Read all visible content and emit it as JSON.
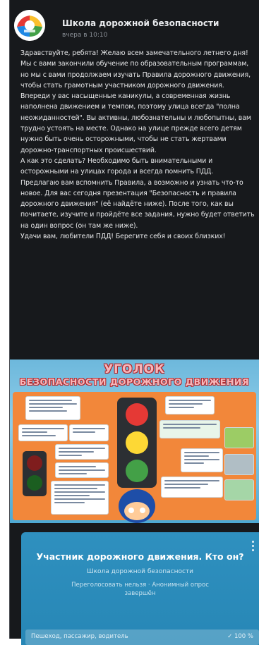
{
  "post": {
    "channel_name": "Школа дорожной безопасности",
    "time": "вчера в 10:10",
    "paragraphs": [
      "Здравствуйте, ребята! Желаю всем замечательного летнего дня!",
      "Мы с вами закончили обучение по образовательным программам, но мы с вами продолжаем изучать Правила дорожного движения, чтобы стать грамотным участником дорожного движения.",
      "Впереди у вас насыщенные каникулы, а современная жизнь наполнена движением и темпом, поэтому улица всегда \"полна неожиданностей\". Вы активны, любознательны и любопытны, вам трудно устоять на месте. Однако на улице прежде всего детям нужно быть очень осторожными, чтобы не стать жертвами дорожно-транспортных происшествий.",
      "А как это сделать? Необходимо быть внимательными и осторожными на улицах города и всегда помнить ПДД.",
      "Предлагаю вам вспомнить Правила, а возможно и узнать что-то новое. Для вас сегодня презентация \"Безопасность и правила дорожного движения\" (её найдёте ниже). После того, как вы почитаете, изучите и пройдёте все задания, нужно будет ответить на один вопрос (он там же ниже).",
      "Удачи вам, любители ПДД! Берегите себя и своих близких!"
    ]
  },
  "poster": {
    "title_line1": "УГОЛОК",
    "title_line2": "БЕЗОПАСНОСТИ ДОРОЖНОГО ДВИЖЕНИЯ"
  },
  "poll": {
    "question": "Участник дорожного движения. Кто он?",
    "channel": "Школа дорожной безопасности",
    "meta": "Переголосовать нельзя · Анонимный опрос завершён",
    "option_label": "Пешеход, пассажир, водитель",
    "option_result": "✓ 100 %"
  },
  "colors": {
    "background": "#17191c",
    "poll_bg": "#2f90bf",
    "poster_panel": "#f2873a"
  }
}
